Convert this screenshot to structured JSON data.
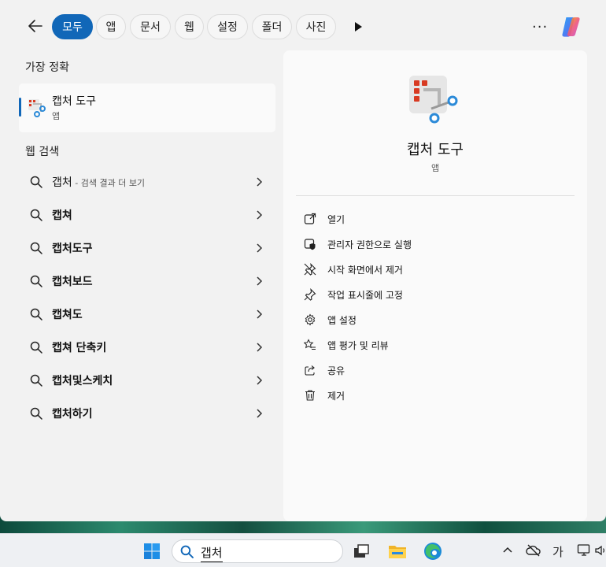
{
  "top": {
    "chips": [
      "모두",
      "앱",
      "문서",
      "웹",
      "설정",
      "폴더",
      "사진"
    ],
    "more": "···"
  },
  "left": {
    "best_match_heading": "가장 정확",
    "best_match": {
      "name": "캡처 도구",
      "type": "앱"
    },
    "web_heading": "웹 검색",
    "web_results": [
      {
        "text": "갭처",
        "suffix": " - 검색 결과 더 보기"
      },
      {
        "text": "캡쳐",
        "suffix": ""
      },
      {
        "text": "캡처도구",
        "suffix": ""
      },
      {
        "text": "캡처보드",
        "suffix": ""
      },
      {
        "text": "캡쳐도",
        "suffix": ""
      },
      {
        "text": "캡쳐 단축키",
        "suffix": ""
      },
      {
        "text": "캡처및스케치",
        "suffix": ""
      },
      {
        "text": "캡처하기",
        "suffix": ""
      }
    ]
  },
  "right": {
    "app_name": "캡처 도구",
    "app_type": "앱",
    "actions": [
      {
        "icon": "open-external-icon",
        "label": "열기"
      },
      {
        "icon": "admin-shield-icon",
        "label": "관리자 권한으로 실행"
      },
      {
        "icon": "unpin-icon",
        "label": "시작 화면에서 제거"
      },
      {
        "icon": "pin-icon",
        "label": "작업 표시줄에 고정"
      },
      {
        "icon": "gear-icon",
        "label": "앱 설정"
      },
      {
        "icon": "star-list-icon",
        "label": "앱 평가 및 리뷰"
      },
      {
        "icon": "share-icon",
        "label": "공유"
      },
      {
        "icon": "trash-icon",
        "label": "제거"
      }
    ]
  },
  "taskbar": {
    "search_value": "갭처",
    "ime_indicator": "가"
  },
  "colors": {
    "accent": "#1167b8"
  }
}
